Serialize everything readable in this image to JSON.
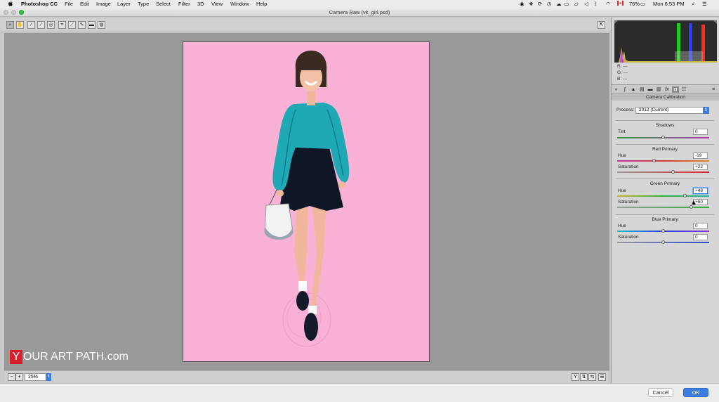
{
  "menubar": {
    "apple": "",
    "app_name": "Photoshop CC",
    "items": [
      "File",
      "Edit",
      "Image",
      "Layer",
      "Type",
      "Select",
      "Filter",
      "3D",
      "View",
      "Window",
      "Help"
    ],
    "battery": "76%",
    "clock": "Mon 6:53 PM"
  },
  "window": {
    "title": "Camera Raw (vk_girl.psd)"
  },
  "canvas": {
    "watermark_letter": "Y",
    "watermark_text": "OUR ART PATH.com",
    "zoom": "25%"
  },
  "panel": {
    "readout": {
      "r_label": "R:",
      "r_value": "---",
      "g_label": "G:",
      "g_value": "---",
      "b_label": "B:",
      "b_value": "---"
    },
    "tab_fx": "fx",
    "section_title": "Camera Calibration",
    "process_label": "Process:",
    "process_value": "2012 (Current)",
    "shadows": {
      "title": "Shadows",
      "tint_label": "Tint",
      "tint_value": "0",
      "tint_level": 0
    },
    "red": {
      "title": "Red Primary",
      "hue_label": "Hue",
      "hue_value": "-19",
      "sat_label": "Saturation",
      "sat_value": "+22"
    },
    "green": {
      "title": "Green Primary",
      "hue_label": "Hue",
      "hue_value": "+48",
      "sat_label": "Saturation",
      "sat_value": "+60"
    },
    "blue": {
      "title": "Blue Primary",
      "hue_label": "Hue",
      "hue_value": "0",
      "sat_label": "Saturation",
      "sat_value": "0"
    }
  },
  "footer": {
    "cancel": "Cancel",
    "ok": "OK"
  },
  "colors": {
    "accent": "#3b7de0",
    "canvas_pink": "#f9b2d6",
    "watermark_red": "#d81e2b"
  }
}
